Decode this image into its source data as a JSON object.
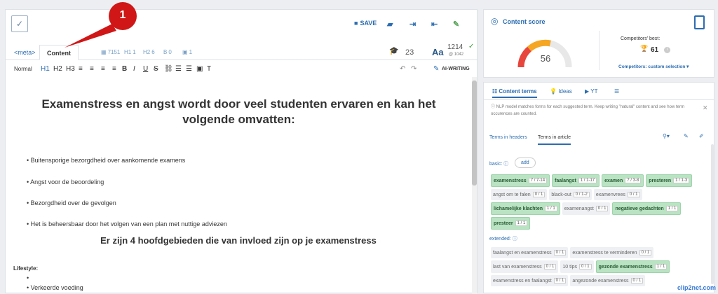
{
  "toolbar": {
    "save_label": "SAVE"
  },
  "tabs": {
    "meta": "<meta>",
    "content": "Content"
  },
  "stats": [
    "7151",
    "1",
    "6",
    "0",
    "1"
  ],
  "word_stats": {
    "grade": "23",
    "count": "1214",
    "sub": "@ 1042"
  },
  "format": {
    "normal": "Normal",
    "h1": "H1",
    "h2": "H2",
    "h3": "H3",
    "bold": "B",
    "italic": "I",
    "underline": "U",
    "strike": "S",
    "ai": "AI-WRITING"
  },
  "doc": {
    "title": "Examenstress en angst wordt door veel studenten ervaren en kan het volgende omvatten:",
    "bullets": [
      "Buitensporige bezorgdheid over aankomende examens",
      "Angst voor de beoordeling",
      "Bezorgdheid over de gevolgen",
      "Het is beheersbaar door het volgen van een plan met nuttige adviezen"
    ],
    "h2": "Er zijn 4 hoofdgebieden die van invloed zijn op je examenstress",
    "lifestyle": "Lifestyle:",
    "sub_bullets": [
      "",
      "Verkeerde voeding",
      ""
    ]
  },
  "score": {
    "title": "Content score",
    "value": "56",
    "competitors_label": "Competitors' best:",
    "competitors_value": "61",
    "selection": "Competitors: custom selection"
  },
  "terms": {
    "tabs": [
      "Content terms",
      "Ideas",
      "YT"
    ],
    "info": "NLP model matches forms for each suggested term. Keep writing \"natural\" content and see how term occurences are counted.",
    "subtabs": [
      "Terms in headers",
      "Terms in article"
    ],
    "basic_label": "basic:",
    "add": "add",
    "basic": [
      {
        "t": "examenstress",
        "c": "7 / 7-14",
        "g": true
      },
      {
        "t": "faalangst",
        "c": "1 / 1-17",
        "g": true
      },
      {
        "t": "examen",
        "c": "7 / 3-8",
        "g": true
      },
      {
        "t": "presteren",
        "c": "1 / 1-3",
        "g": true
      },
      {
        "t": "angst om te falen",
        "c": "0 / 1",
        "g": false
      },
      {
        "t": "black-out",
        "c": "0 / 1-2",
        "g": false
      },
      {
        "t": "examenvrees",
        "c": "0 / 1",
        "g": false
      },
      {
        "t": "lichamelijke klachten",
        "c": "1 / 1",
        "g": true
      },
      {
        "t": "examenangst",
        "c": "0 / 1",
        "g": false
      },
      {
        "t": "negatieve gedachten",
        "c": "1 / 1",
        "g": true
      },
      {
        "t": "presteer",
        "c": "1 / 1",
        "g": true
      }
    ],
    "extended_label": "extended:",
    "extended": [
      {
        "t": "faalangst en examenstress",
        "c": "0 / 1",
        "g": false
      },
      {
        "t": "examenstress te verminderen",
        "c": "0 / 1",
        "g": false
      },
      {
        "t": "last van examenstress",
        "c": "0 / 1",
        "g": false
      },
      {
        "t": "10 tips",
        "c": "0 / 1",
        "g": false
      },
      {
        "t": "gezonde examenstress",
        "c": "1 / 1",
        "g": true
      },
      {
        "t": "examenstress en faalangst",
        "c": "0 / 1",
        "g": false
      },
      {
        "t": "angezonde examenstress",
        "c": "0 / 1",
        "g": false
      }
    ]
  },
  "callout": "1",
  "watermark": "clip2net.com"
}
